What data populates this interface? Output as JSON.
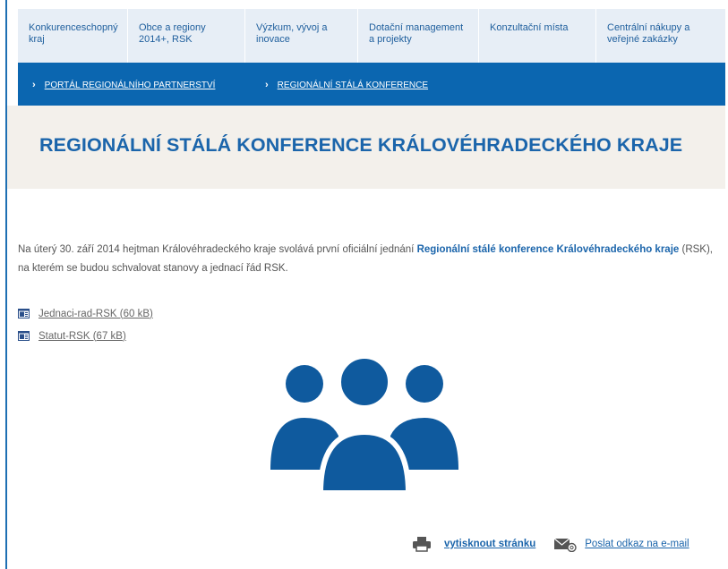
{
  "colors": {
    "brand_blue": "#0b66b0",
    "nav_bg": "#e7eef6",
    "hero_bg": "#f3f0eb",
    "heading": "#1b65ab"
  },
  "topnav": [
    {
      "label": "Konkurenceschopný kraj"
    },
    {
      "label": "Obce a regiony 2014+, RSK"
    },
    {
      "label": "Výzkum, vývoj a inovace"
    },
    {
      "label": "Dotační management a projekty"
    },
    {
      "label": "Konzultační místa"
    },
    {
      "label": "Centrální nákupy a veřejné zakázky"
    }
  ],
  "breadcrumb": {
    "separator_icon": "chevron-right-icon",
    "items": [
      {
        "label": "PORTÁL REGIONÁLNÍHO PARTNERSTVÍ"
      },
      {
        "label": "REGIONÁLNÍ STÁLÁ KONFERENCE"
      }
    ]
  },
  "page": {
    "title": "REGIONÁLNÍ STÁLÁ KONFERENCE KRÁLOVÉHRADECKÉHO KRAJE"
  },
  "intro": {
    "before": "Na úterý 30. září 2014 hejtman Královéhradeckého kraje svolává první oficiální jednání ",
    "strong": "Regionální stálé konference Královéhradeckého kraje",
    "after": " (RSK), na kterém se budou schvalovat stanovy a jednací řád RSK."
  },
  "attachments": [
    {
      "label": "Jednaci-rad-RSK (60 kB)",
      "icon": "word-document-icon"
    },
    {
      "label": "Statut-RSK (67 kB)",
      "icon": "word-document-icon"
    }
  ],
  "illustration": {
    "icon": "people-group-icon"
  },
  "footer": {
    "print_label": "vytisknout stránku",
    "print_icon": "printer-icon",
    "mail_label": "Poslat odkaz na e-mail",
    "mail_icon": "email-icon"
  }
}
